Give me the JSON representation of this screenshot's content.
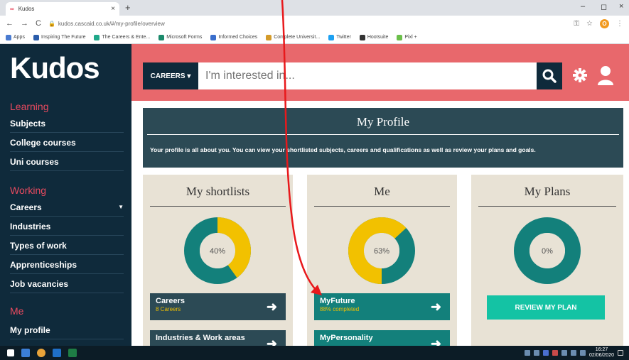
{
  "browser": {
    "tab_title": "Kudos",
    "tab_favicon": "∞",
    "url": "kudos.cascaid.co.uk/#/my-profile/overview",
    "bookmarks": [
      "Apps",
      "Inspiring The Future",
      "The Careers & Ente...",
      "Microsoft Forms",
      "Informed Choices",
      "Complete Universit...",
      "Twitter",
      "Hootsuite",
      "Pixl +"
    ],
    "profile_initial": "O"
  },
  "sidebar": {
    "logo": "Kudos",
    "sections": [
      {
        "title": "Learning",
        "items": [
          "Subjects",
          "College courses",
          "Uni courses"
        ]
      },
      {
        "title": "Working",
        "items": [
          "Careers",
          "Industries",
          "Types of work",
          "Apprenticeships",
          "Job vacancies"
        ]
      },
      {
        "title": "Me",
        "items": [
          "My profile"
        ]
      }
    ]
  },
  "header": {
    "careers_label": "CAREERS ▾",
    "search_placeholder": "I'm interested in..."
  },
  "profile": {
    "title": "My Profile",
    "description": "Your profile is all about you. You can view your shortlisted subjects, careers and qualifications as well as review your plans and goals."
  },
  "cards": {
    "shortlists": {
      "title": "My shortlists",
      "percent": 40,
      "percent_label": "40%",
      "actions": [
        {
          "title": "Careers",
          "subtitle": "8 Careers"
        },
        {
          "title": "Industries & Work areas",
          "subtitle": ""
        }
      ]
    },
    "me": {
      "title": "Me",
      "percent": 63,
      "percent_label": "63%",
      "actions": [
        {
          "title": "MyFuture",
          "subtitle": "88% completed"
        },
        {
          "title": "MyPersonality",
          "subtitle": ""
        }
      ]
    },
    "plans": {
      "title": "My Plans",
      "percent": 0,
      "percent_label": "0%",
      "button": "REVIEW MY PLAN"
    }
  },
  "taskbar": {
    "time": "16:27",
    "date": "02/06/2020"
  },
  "colors": {
    "navy": "#0f2a3b",
    "coral": "#e8686c",
    "teal": "#13807b",
    "yellow": "#f2c100",
    "beige": "#e8e2d5",
    "mint": "#14c3a4",
    "annotation": "#e8191c"
  }
}
